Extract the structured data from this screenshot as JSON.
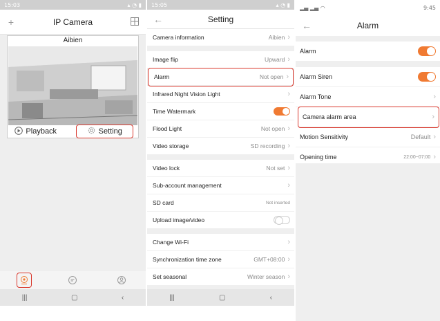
{
  "colors": {
    "accent": "#f07a32",
    "highlight": "#d9362b"
  },
  "phone1": {
    "status_time": "15:03",
    "title": "IP Camera",
    "camera_name": "Aibien",
    "playback_label": "Playback",
    "setting_label": "Setting",
    "add_icon": "plus-icon",
    "grid_icon": "grid-icon"
  },
  "phone2": {
    "status_time": "15:05",
    "title": "Setting",
    "rows": [
      {
        "label": "Camera information",
        "value": "Aibien"
      },
      {
        "label": "Image flip",
        "value": "Upward"
      },
      {
        "label": "Alarm",
        "value": "Not open"
      },
      {
        "label": "Infrared Night Vision Light",
        "value": ""
      },
      {
        "label": "Time Watermark",
        "toggle": true
      },
      {
        "label": "Flood Light",
        "value": "Not open"
      },
      {
        "label": "Video storage",
        "value": "SD recording"
      },
      {
        "label": "Video lock",
        "value": "Not set"
      },
      {
        "label": "Sub-account management",
        "value": ""
      },
      {
        "label": "SD card",
        "value": "Not inserted"
      },
      {
        "label": "Upload image/video",
        "toggle": false
      },
      {
        "label": "Change Wi-Fi",
        "value": ""
      },
      {
        "label": "Synchronization time zone",
        "value": "GMT+08:00"
      },
      {
        "label": "Set seasonal",
        "value": "Winter season"
      }
    ]
  },
  "phone3": {
    "title": "Alarm",
    "status_right": "9:45",
    "rows": [
      {
        "label": "Alarm",
        "toggle": true
      },
      {
        "label": "Alarm Siren",
        "toggle": true
      },
      {
        "label": "Alarm Tone",
        "value": ""
      },
      {
        "label": "Camera alarm area",
        "value": ""
      },
      {
        "label": "Motion Sensitivity",
        "value": "Default"
      },
      {
        "label": "Opening time",
        "value": "22:00~07:00"
      }
    ]
  }
}
